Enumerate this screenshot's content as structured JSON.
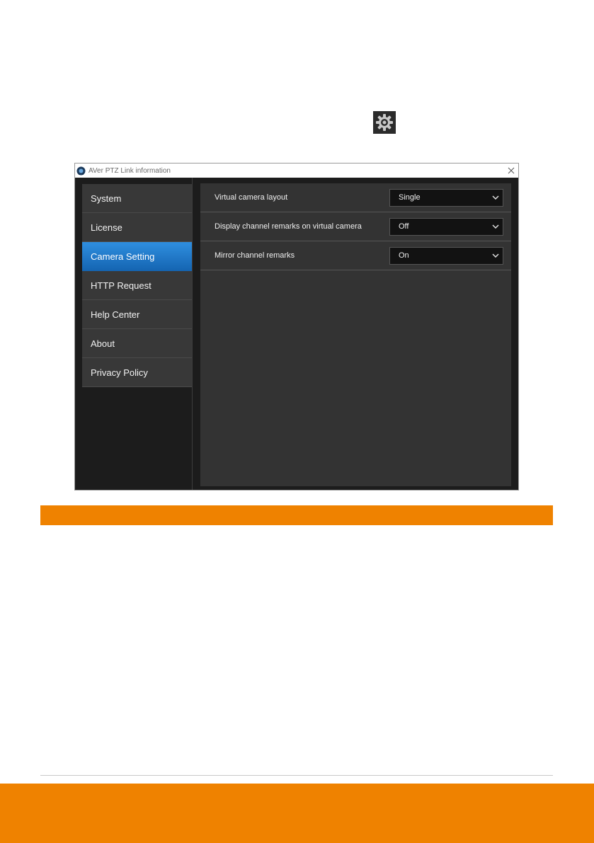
{
  "window": {
    "title": "AVer PTZ Link information"
  },
  "sidebar": {
    "items": [
      {
        "label": "System",
        "active": false
      },
      {
        "label": "License",
        "active": false
      },
      {
        "label": "Camera Setting",
        "active": true
      },
      {
        "label": "HTTP Request",
        "active": false
      },
      {
        "label": "Help Center",
        "active": false
      },
      {
        "label": "About",
        "active": false
      },
      {
        "label": "Privacy Policy",
        "active": false
      }
    ]
  },
  "settings": {
    "rows": [
      {
        "label": "Virtual camera layout",
        "value": "Single"
      },
      {
        "label": "Display channel remarks on virtual camera",
        "value": "Off"
      },
      {
        "label": "Mirror channel remarks",
        "value": "On"
      }
    ]
  },
  "colors": {
    "accent_orange": "#ef8200",
    "active_blue": "#1f7ed0",
    "panel_dark": "#333333",
    "sidebar_dark": "#1c1c1c"
  },
  "icons": {
    "inline": "gear-icon",
    "close": "close-icon",
    "dropdown": "chevron-down-icon",
    "logo": "app-logo-icon"
  }
}
